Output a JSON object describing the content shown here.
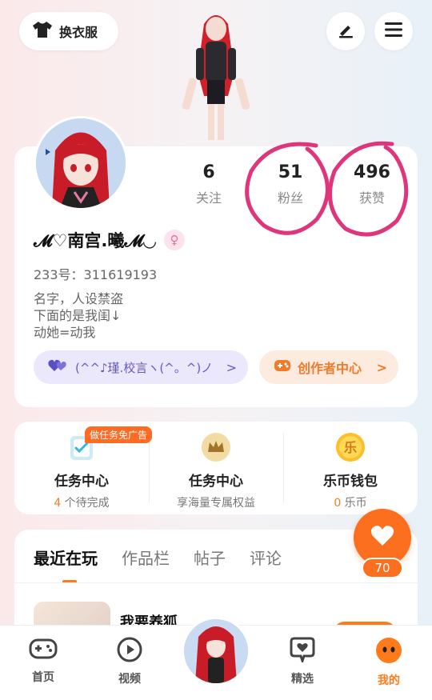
{
  "header": {
    "outfit_label": "换衣服"
  },
  "profile": {
    "stats": [
      {
        "value": "6",
        "label": "关注"
      },
      {
        "value": "51",
        "label": "粉丝"
      },
      {
        "value": "496",
        "label": "获赞"
      }
    ],
    "username": "𝓜♡南宫.曦𝓜◡",
    "gender_symbol": "♀",
    "uid_line": "233号：311619193",
    "bio_lines": [
      "名字，人设禁盗",
      "下面的是我闺↓",
      "动她=动我"
    ],
    "guild_label": "(^^♪瑾.校言ヽ(^。^)ノ",
    "creator_label": "创作者中心"
  },
  "tasks": {
    "ad_tag": "做任务免广告",
    "items": [
      {
        "title": "任务中心",
        "sub_highlight": "4",
        "sub_text": " 个待完成"
      },
      {
        "title": "任务中心",
        "sub_highlight": "",
        "sub_text": "享海量专属权益"
      },
      {
        "title": "乐币钱包",
        "sub_highlight": "0",
        "sub_text": " 乐币"
      }
    ],
    "coin_icon_char": "乐"
  },
  "tabs": [
    "最近在玩",
    "作品栏",
    "帖子",
    "评论"
  ],
  "recent": {
    "game_title": "我要养狐"
  },
  "likes_fab": {
    "count": "70"
  },
  "nav": [
    {
      "label": "首页",
      "icon": "gamepad-icon"
    },
    {
      "label": "视频",
      "icon": "play-icon"
    },
    {
      "label": "",
      "icon": "avatar"
    },
    {
      "label": "精选",
      "icon": "heart-chat-icon"
    },
    {
      "label": "我的",
      "icon": "face-icon"
    }
  ],
  "colors": {
    "accent": "#ff7a1a",
    "guild_text": "#6659c8",
    "annotation": "#e0357a"
  }
}
